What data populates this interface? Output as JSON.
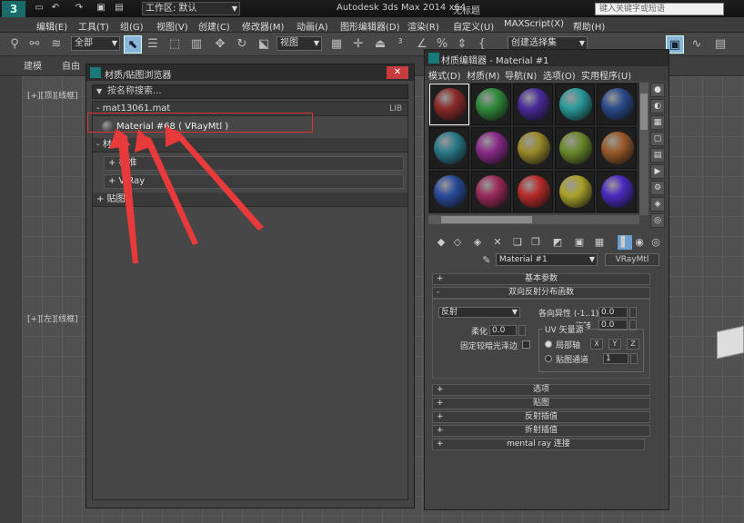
{
  "titlebar": {
    "workspace": "工作区: 默认",
    "app_title": "Autodesk 3ds Max  2014 x64",
    "doc_title": "无标题",
    "search_placeholder": "键入关键字或短语"
  },
  "menu": [
    "编辑(E)",
    "工具(T)",
    "组(G)",
    "视图(V)",
    "创建(C)",
    "修改器(M)",
    "动画(A)",
    "图形编辑器(D)",
    "渲染(R)",
    "自定义(U)",
    "MAXScript(X)",
    "帮助(H)"
  ],
  "toolbar": {
    "filter_value": "全部",
    "refcoord_value": "视图",
    "selection_set_value": "创建选择集"
  },
  "ribbon": {
    "tabs": [
      "建模",
      "自由"
    ]
  },
  "viewports": {
    "top_left_label": "[+][顶][线框]",
    "bottom_left_label": "[+][左][线框]"
  },
  "material_browser": {
    "title": "材质/贴图浏览器",
    "search_text": "按名称搜索...",
    "library_name": "- mat13061.mat",
    "library_tag": "LIB",
    "item_name": "Material #68 ( VRayMtl )",
    "sections": [
      "- 材质",
      "+ 标准",
      "+ V-Ray",
      "+ 贴图"
    ]
  },
  "material_editor": {
    "title": "材质编辑器 - Material #1",
    "menu": [
      "模式(D)",
      "材质(M)",
      "导航(N)",
      "选项(O)",
      "实用程序(U)"
    ],
    "material_name": "Material #1",
    "material_type": "VRayMtl",
    "rollouts": {
      "basic_params": "基本参数",
      "brdf": "双向反射分布函数",
      "options": "选项",
      "maps": "贴图",
      "reflect_interp": "反射插值",
      "refract_interp": "折射插值",
      "mental_ray": "mental ray 连接"
    },
    "brdf": {
      "type": "反射",
      "anisotropy_label": "各向异性 (-1..1)",
      "anisotropy_value": "0.0",
      "rotation_label": "旋转",
      "rotation_value": "0.0",
      "soften_label": "柔化",
      "soften_value": "0.0",
      "fix_dark_label": "固定较暗光泽边",
      "uv_group_label": "UV 矢量源",
      "local_axis_label": "局部轴",
      "map_channel_label": "贴图通道",
      "map_channel_value": "1",
      "axis_x": "X",
      "axis_y": "Y",
      "axis_z": "Z"
    },
    "sphere_colors": [
      "#8a2a2a",
      "#2f8a3a",
      "#4a2a9a",
      "#2a9a9a",
      "#2a4a8a",
      "#2a7a8a",
      "#8a2a8a",
      "#9a8a2a",
      "#6a8a2a",
      "#9a5a2a",
      "#2a4a9a",
      "#9a2a5a",
      "#b82a2a",
      "#aaa22a",
      "#4a2ac0"
    ]
  }
}
